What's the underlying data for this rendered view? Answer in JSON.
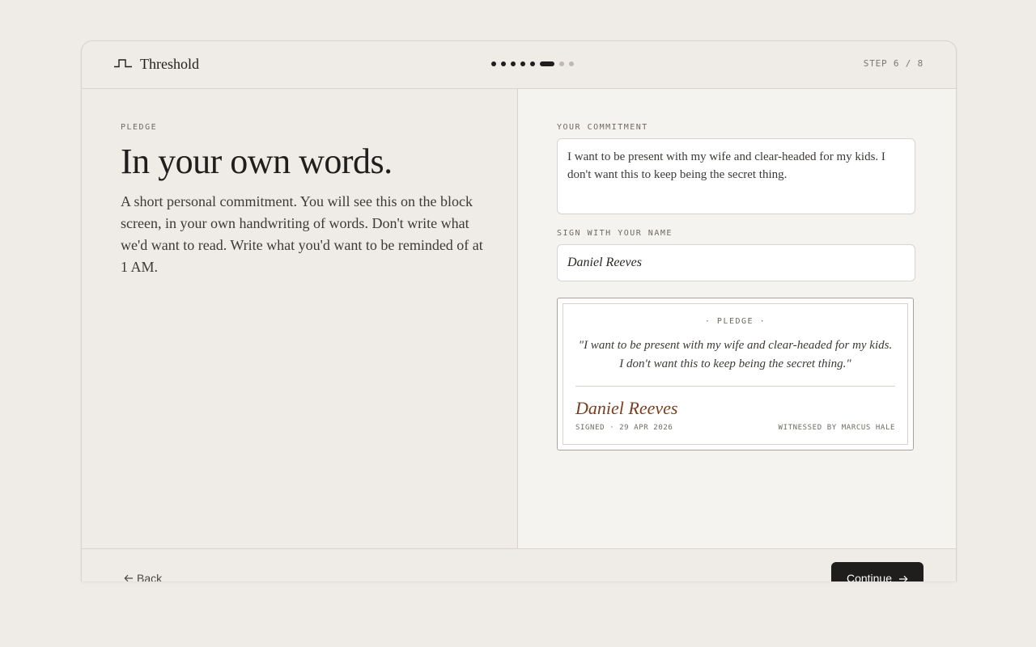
{
  "app": {
    "brand": "Threshold",
    "step": "STEP 6 / 8"
  },
  "progress": {
    "total": 8,
    "current": 6
  },
  "left": {
    "eyebrow": "PLEDGE",
    "title": "In your own words.",
    "description": "A short personal commitment. You will see this on the block screen, in your own handwriting of words. Don't write what we'd want to read. Write what you'd want to be reminded of at 1 AM."
  },
  "form": {
    "commitment_label": "YOUR COMMITMENT",
    "commitment_value": "I want to be present with my wife and clear-headed for my kids. I don't want this to keep being the secret thing.",
    "sign_label": "SIGN WITH YOUR NAME",
    "sign_value": "Daniel Reeves"
  },
  "card": {
    "eyebrow": "· PLEDGE ·",
    "quote": "\"I want to be present with my wife and clear-headed for my kids. I don't want this to keep being the secret thing.\"",
    "signature": "Daniel Reeves",
    "signed": "SIGNED · 29 APR 2026",
    "witness": "WITNESSED BY MARCUS HALE"
  },
  "footer": {
    "back_label": "Back",
    "continue_label": "Continue"
  },
  "colors": {
    "accent_signature": "#7a3d1e",
    "primary_button": "#1f1e1c"
  },
  "icons": {
    "brand": "threshold-logo-icon",
    "back": "arrow-left-icon",
    "continue": "arrow-right-icon"
  }
}
